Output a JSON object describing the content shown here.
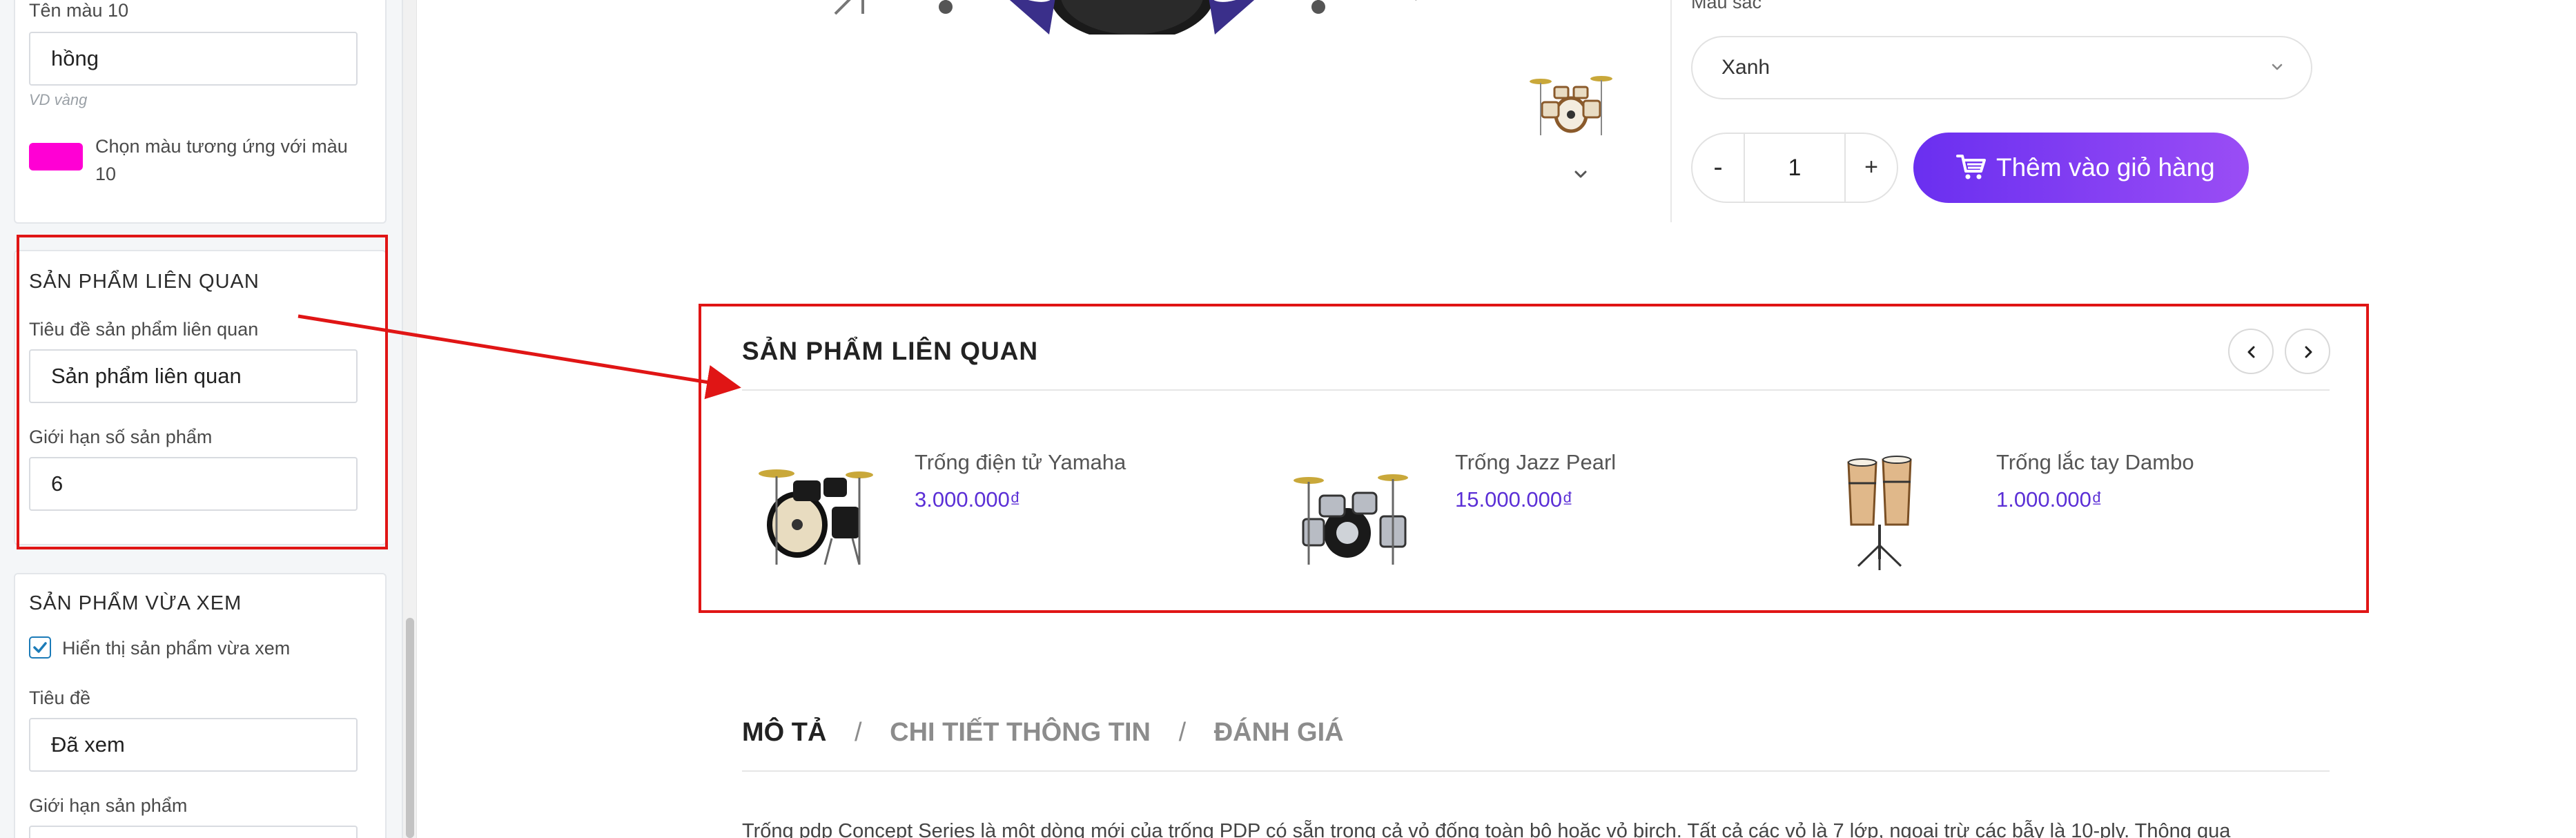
{
  "sidebar": {
    "color10": {
      "label": "Tên màu 10",
      "value": "hồng",
      "hint": "VD vàng",
      "swatch_color": "#ff00d4",
      "swatch_text": "Chọn màu tương ứng với màu 10"
    },
    "related": {
      "section_title": "SẢN PHẨM LIÊN QUAN",
      "title_label": "Tiêu đề sản phẩm liên quan",
      "title_value": "Sản phẩm liên quan",
      "limit_label": "Giới hạn số sản phẩm",
      "limit_value": "6"
    },
    "recent": {
      "section_title": "SẢN PHẨM VỪA XEM",
      "show_label": "Hiển thị sản phẩm vừa xem",
      "show_checked": true,
      "title_label": "Tiêu đề",
      "title_value": "Đã xem",
      "limit_label": "Giới hạn sản phẩm"
    }
  },
  "product": {
    "color_label": "Màu sắc",
    "color_value": "Xanh",
    "quantity": "1",
    "minus": "-",
    "plus": "+",
    "add_to_cart": "Thêm vào giỏ hàng",
    "accent_color": "#7b3ff2"
  },
  "related_section": {
    "title": "SẢN PHẨM LIÊN QUAN",
    "items": [
      {
        "name": "Trống điện tử Yamaha",
        "price": "3.000.000₫"
      },
      {
        "name": "Trống Jazz Pearl",
        "price": "15.000.000₫"
      },
      {
        "name": "Trống lắc tay Dambo",
        "price": "1.000.000₫"
      }
    ]
  },
  "tabs": {
    "description": "MÔ TẢ",
    "separator": "/",
    "details": "CHI TIẾT THÔNG TIN",
    "reviews": "ĐÁNH GIÁ"
  },
  "description_text": "Trống pdp Concept Series là một dòng mới của trống PDP có sẵn trong cả vỏ đống toàn bộ hoặc vỏ birch. Tất cả các vỏ là 7 lớp, ngoại trừ các bẫy là 10-ply. Thông qua",
  "annotation_color": "#e01515"
}
